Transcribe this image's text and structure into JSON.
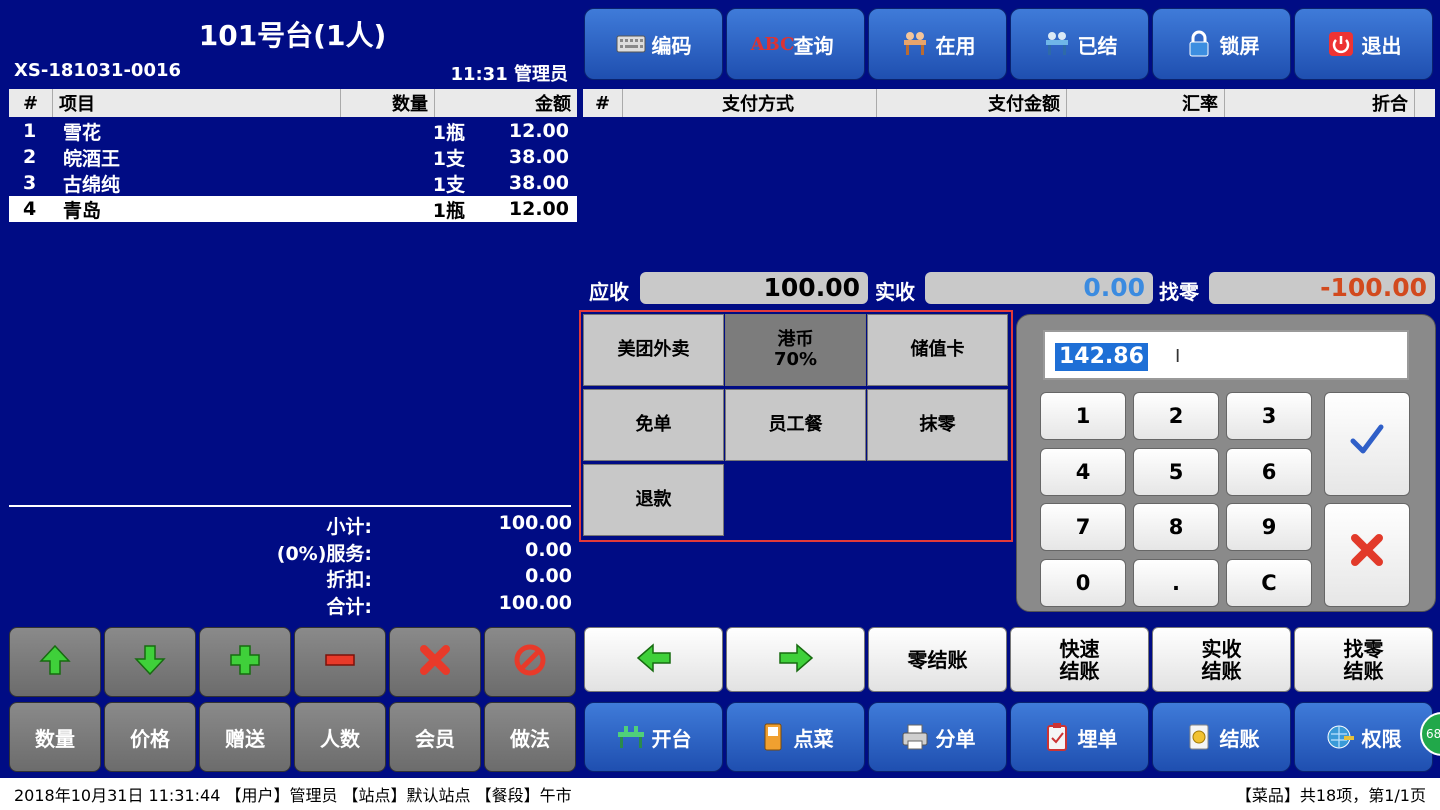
{
  "header": {
    "table_title": "101号台(1人)",
    "order_no": "XS-181031-0016",
    "time_user": "11:31  管理员"
  },
  "order_table": {
    "headers": [
      "#",
      "项目",
      "数量",
      "金额"
    ],
    "rows": [
      {
        "no": "1",
        "name": "雪花",
        "qty": "1瓶",
        "amount": "12.00"
      },
      {
        "no": "2",
        "name": "皖酒王",
        "qty": "1支",
        "amount": "38.00"
      },
      {
        "no": "3",
        "name": "古绵纯",
        "qty": "1支",
        "amount": "38.00"
      },
      {
        "no": "4",
        "name": "青岛",
        "qty": "1瓶",
        "amount": "12.00"
      }
    ],
    "selected_row": 4
  },
  "summary": {
    "subtotal_label": "小计:",
    "subtotal": "100.00",
    "service_label": "(0%)服务:",
    "service": "0.00",
    "discount_label": "折扣:",
    "discount": "0.00",
    "total_label": "合计:",
    "total": "100.00"
  },
  "top_buttons": [
    "编码",
    "查询",
    "在用",
    "已结",
    "锁屏",
    "退出"
  ],
  "payment_table": {
    "headers": [
      "#",
      "支付方式",
      "支付金额",
      "汇率",
      "折合"
    ]
  },
  "amounts": {
    "receivable_label": "应收",
    "receivable": "100.00",
    "received_label": "实收",
    "received": "0.00",
    "change_label": "找零",
    "change": "-100.00"
  },
  "payment_methods": [
    {
      "label": "美团外卖",
      "sub": ""
    },
    {
      "label": "港币",
      "sub": "70%"
    },
    {
      "label": "储值卡",
      "sub": ""
    },
    {
      "label": "免单",
      "sub": ""
    },
    {
      "label": "员工餐",
      "sub": ""
    },
    {
      "label": "抹零",
      "sub": ""
    },
    {
      "label": "退款",
      "sub": ""
    }
  ],
  "keypad": {
    "input_value": "142.86",
    "keys": [
      "1",
      "2",
      "3",
      "4",
      "5",
      "6",
      "7",
      "8",
      "9",
      "0",
      ".",
      "C"
    ]
  },
  "left_action_buttons": [
    "数量",
    "价格",
    "赠送",
    "人数",
    "会员",
    "做法"
  ],
  "settle_buttons": {
    "zero": "零结账",
    "quick": [
      "快速",
      "结账"
    ],
    "actual": [
      "实收",
      "结账"
    ],
    "change": [
      "找零",
      "结账"
    ]
  },
  "bottom_buttons": [
    "开台",
    "点菜",
    "分单",
    "埋单",
    "结账",
    "权限"
  ],
  "status_bar": {
    "left": "2018年10月31日 11:31:44 【用户】管理员 【站点】默认站点 【餐段】午市",
    "right": "【菜品】共18项，第1/1页"
  },
  "badge": "68",
  "colors": {
    "background": "#000c84",
    "received": "#3b8be0",
    "change": "#d24a1e",
    "highlight_border": "#e23a3a"
  }
}
